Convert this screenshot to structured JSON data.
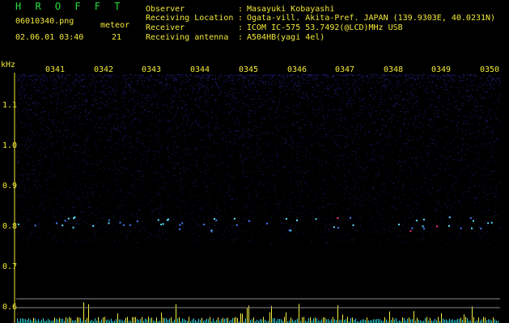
{
  "header": {
    "brand": "H R O F F T",
    "filename": "06010340.png",
    "datetime": "02.06.01 03:40",
    "meteor_label": "meteor",
    "meteor_count": "21",
    "fields": [
      {
        "label": "Observer",
        "value": "Masayuki Kobayashi"
      },
      {
        "label": "Receiving Location",
        "value": "Ogata-vill. Akita-Pref. JAPAN (139.9303E, 40.0231N)"
      },
      {
        "label": "Receiver",
        "value": "ICOM IC-575 53.7492(@LCD)MHz USB"
      },
      {
        "label": "Receiving antenna",
        "value": "A504HB(yagi 4el)"
      }
    ],
    "sep": ":"
  },
  "spectrogram": {
    "unit_label": "kHz",
    "time_labels": [
      "0341",
      "0342",
      "0343",
      "0344",
      "0345",
      "0346",
      "0347",
      "0348",
      "0349",
      "0350"
    ],
    "freq_labels": [
      "1.1",
      "1.0",
      "0.9",
      "0.8",
      "0.7",
      "0.6"
    ],
    "colors": {
      "noise": "#1a1a8c",
      "signal": "#33d6ff",
      "bg": "#000000",
      "text": "#f2e838",
      "bars": "#f2f040"
    }
  }
}
